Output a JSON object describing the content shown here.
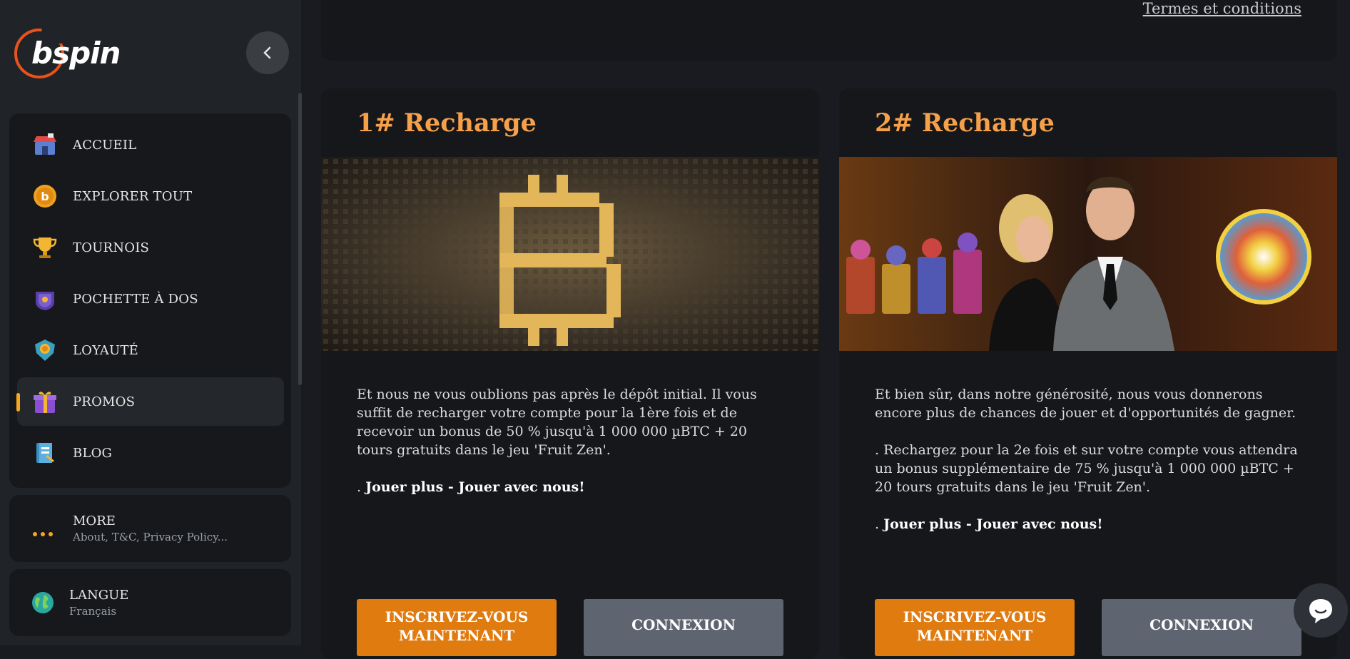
{
  "brand": {
    "logo_text": "bspin"
  },
  "sidebar": {
    "items": [
      {
        "label": "ACCUEIL",
        "icon": "shop-icon"
      },
      {
        "label": "EXPLORER TOUT",
        "icon": "bitcoin-coin-icon"
      },
      {
        "label": "TOURNOIS",
        "icon": "trophy-icon"
      },
      {
        "label": "POCHETTE À DOS",
        "icon": "backpack-icon"
      },
      {
        "label": "LOYAUTÉ",
        "icon": "loyalty-badge-icon"
      },
      {
        "label": "PROMOS",
        "icon": "gift-icon",
        "active": true
      },
      {
        "label": "BLOG",
        "icon": "book-icon"
      }
    ],
    "more": {
      "title": "MORE",
      "subtitle": "About, T&C, Privacy Policy..."
    },
    "language": {
      "title": "LANGUE",
      "value": "Français"
    }
  },
  "header": {
    "terms_link": "Termes et conditions"
  },
  "promos": [
    {
      "title": "1# Recharge",
      "paragraphs": [
        "Et nous ne vous oublions pas après le dépôt initial. Il vous suffit de recharger votre compte pour la 1ère fois et de recevoir un bonus de 50 % jusqu'à 1 000 000 µBTC + 20 tours gratuits dans le jeu 'Fruit Zen'."
      ],
      "cta_prefix": ". ",
      "cta_bold": "Jouer plus - Jouer avec nous!",
      "signup_label": "INSCRIVEZ-VOUS MAINTENANT",
      "login_label": "CONNEXION"
    },
    {
      "title": "2# Recharge",
      "paragraphs": [
        "Et bien sûr, dans notre générosité, nous vous donnerons encore plus de chances de jouer et d'opportunités de gagner.",
        ". Rechargez pour la 2e fois et sur votre compte vous attendra un bonus supplémentaire de 75 % jusqu'à 1 000 000 µBTC + 20 tours gratuits dans le jeu 'Fruit Zen'."
      ],
      "cta_prefix": ". ",
      "cta_bold": "Jouer plus - Jouer avec nous!",
      "signup_label": "INSCRIVEZ-VOUS MAINTENANT",
      "login_label": "CONNEXION"
    }
  ],
  "colors": {
    "accent_orange": "#f6a04a",
    "signup_button": "#e07b0f",
    "login_button": "#5e6570",
    "logo_ring": "#e8531c"
  }
}
